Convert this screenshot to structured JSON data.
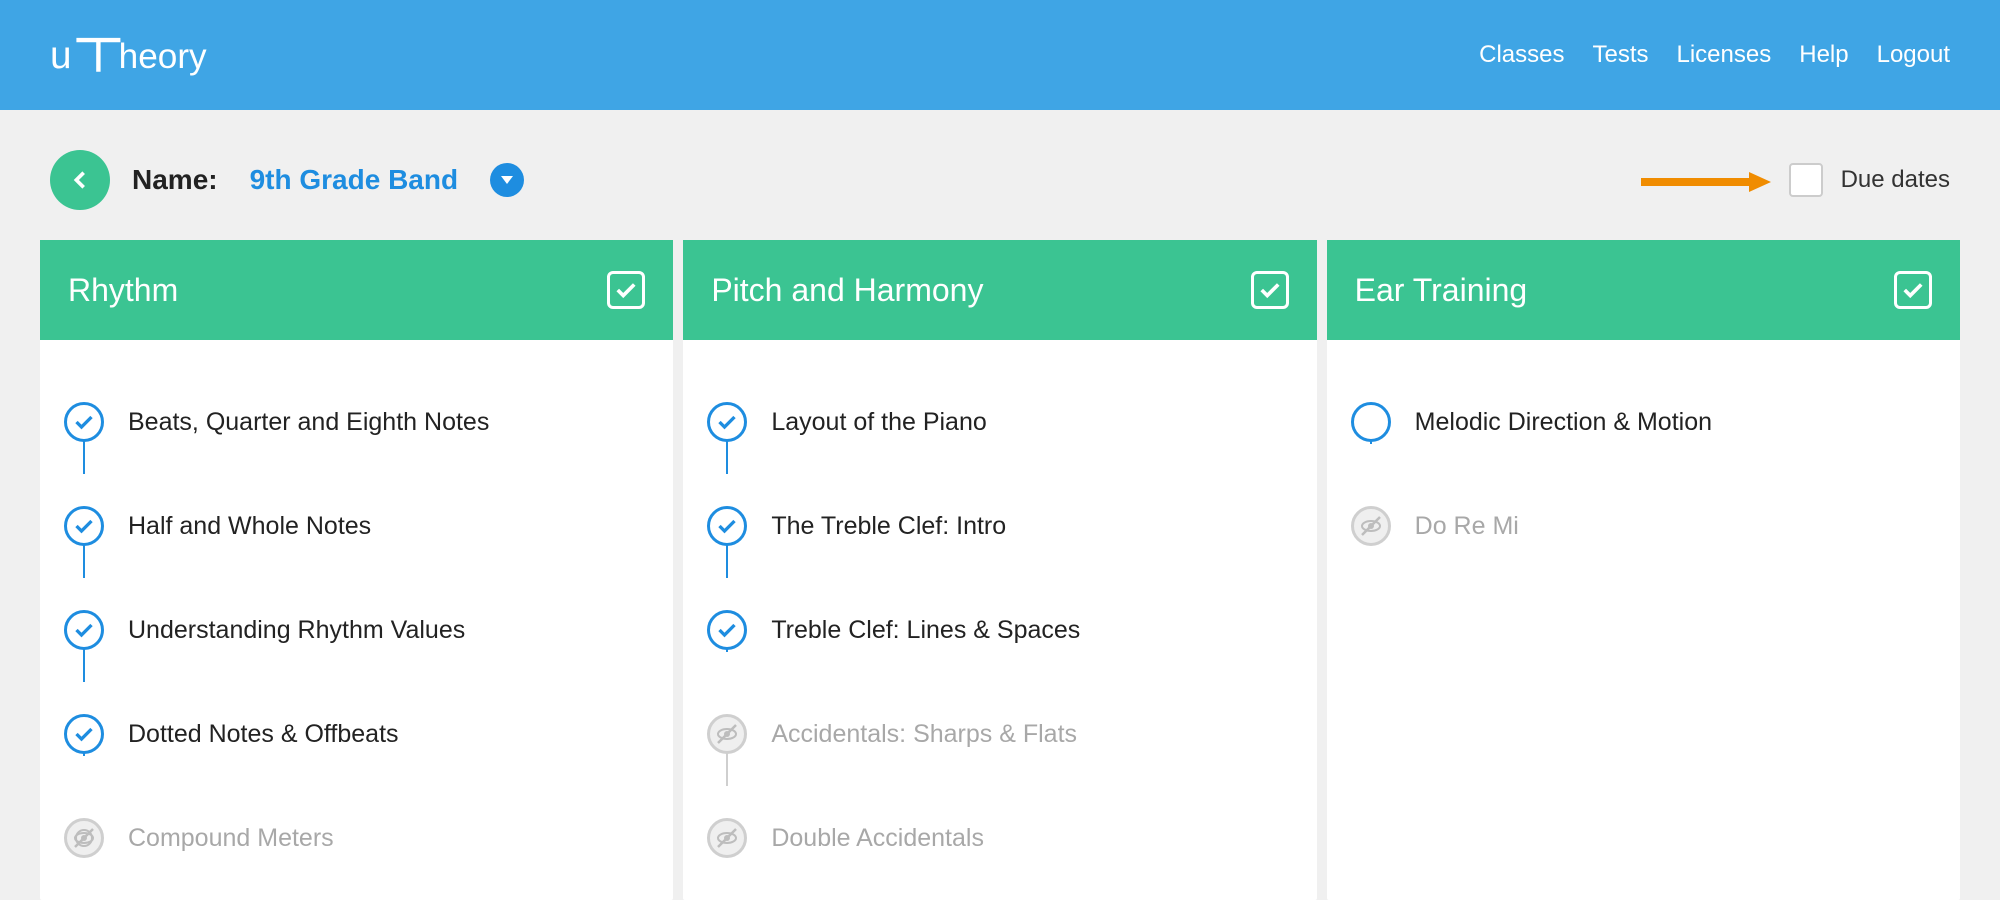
{
  "header": {
    "logo_text": "uTheory",
    "nav": [
      "Classes",
      "Tests",
      "Licenses",
      "Help",
      "Logout"
    ]
  },
  "subheader": {
    "name_label": "Name:",
    "class_name": "9th Grade Band",
    "due_dates_label": "Due dates"
  },
  "columns": [
    {
      "title": "Rhythm",
      "lessons": [
        {
          "label": "Beats, Quarter and Eighth Notes",
          "status": "checked"
        },
        {
          "label": "Half and Whole Notes",
          "status": "checked"
        },
        {
          "label": "Understanding Rhythm Values",
          "status": "checked"
        },
        {
          "label": "Dotted Notes & Offbeats",
          "status": "checked"
        },
        {
          "label": "Compound Meters",
          "status": "disabled"
        }
      ]
    },
    {
      "title": "Pitch and Harmony",
      "lessons": [
        {
          "label": "Layout of the Piano",
          "status": "checked"
        },
        {
          "label": "The Treble Clef: Intro",
          "status": "checked"
        },
        {
          "label": "Treble Clef: Lines & Spaces",
          "status": "checked"
        },
        {
          "label": "Accidentals: Sharps & Flats",
          "status": "disabled"
        },
        {
          "label": "Double Accidentals",
          "status": "disabled"
        }
      ]
    },
    {
      "title": "Ear Training",
      "lessons": [
        {
          "label": "Melodic Direction & Motion",
          "status": "empty"
        },
        {
          "label": "Do Re Mi",
          "status": "disabled"
        }
      ]
    }
  ]
}
